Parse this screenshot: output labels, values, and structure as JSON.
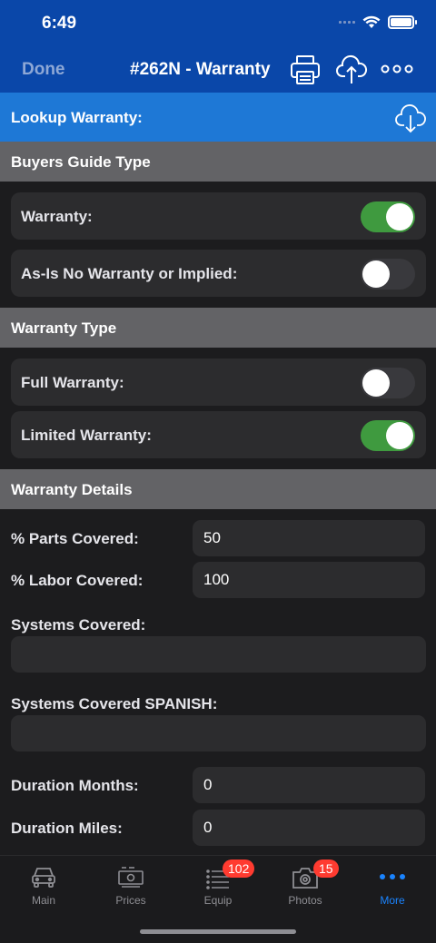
{
  "status_bar": {
    "time": "6:49"
  },
  "nav": {
    "done_label": "Done",
    "title": "#262N - Warranty"
  },
  "lookup": {
    "label": "Lookup Warranty:"
  },
  "sections": {
    "buyers_guide": {
      "title": "Buyers Guide Type",
      "rows": [
        {
          "label": "Warranty:",
          "on": true
        },
        {
          "label": "As-Is No Warranty or Implied:",
          "on": false
        }
      ]
    },
    "warranty_type": {
      "title": "Warranty Type",
      "rows": [
        {
          "label": "Full Warranty:",
          "on": false
        },
        {
          "label": "Limited Warranty:",
          "on": true
        }
      ]
    },
    "warranty_details": {
      "title": "Warranty Details",
      "parts_label": "% Parts Covered:",
      "parts_value": "50",
      "labor_label": "% Labor Covered:",
      "labor_value": "100",
      "systems_label": "Systems Covered:",
      "systems_value": "",
      "systems_spanish_label": "Systems Covered SPANISH:",
      "systems_spanish_value": "",
      "months_label": "Duration Months:",
      "months_value": "0",
      "miles_label": "Duration Miles:",
      "miles_value": "0"
    }
  },
  "tabs": [
    {
      "label": "Main",
      "icon": "car-icon",
      "badge": ""
    },
    {
      "label": "Prices",
      "icon": "cash-icon",
      "badge": ""
    },
    {
      "label": "Equip",
      "icon": "list-icon",
      "badge": "102"
    },
    {
      "label": "Photos",
      "icon": "camera-icon",
      "badge": "15"
    },
    {
      "label": "More",
      "icon": "more-dots-icon",
      "badge": "",
      "active": true
    }
  ],
  "colors": {
    "nav_bg": "#0a47a9",
    "lookup_bg": "#1e78d6",
    "section_bg": "#636366",
    "toggle_on": "#3f9a3f",
    "active_tab": "#1a84ff",
    "badge": "#ff3b30"
  }
}
